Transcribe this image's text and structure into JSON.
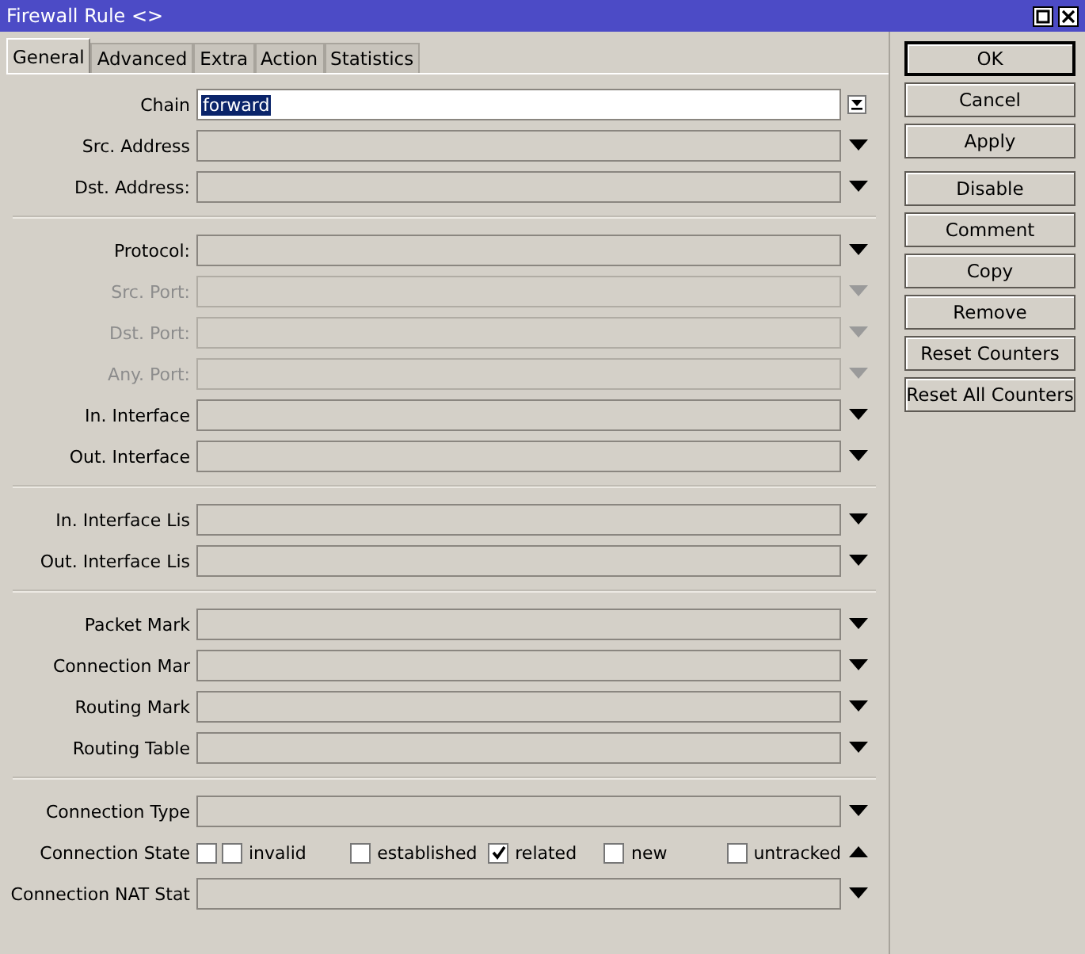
{
  "window": {
    "title": "Firewall Rule <>"
  },
  "tabs": [
    {
      "label": "General",
      "selected": true
    },
    {
      "label": "Advanced",
      "selected": false
    },
    {
      "label": "Extra",
      "selected": false
    },
    {
      "label": "Action",
      "selected": false
    },
    {
      "label": "Statistics",
      "selected": false
    }
  ],
  "groups": [
    [
      {
        "kind": "select",
        "label": "Chain",
        "value": "forward",
        "value_selected": true
      },
      {
        "kind": "combo",
        "label": "Src. Address",
        "disabled": false
      },
      {
        "kind": "combo",
        "label": "Dst. Address:",
        "disabled": false
      }
    ],
    [
      {
        "kind": "combo",
        "label": "Protocol:",
        "disabled": false
      },
      {
        "kind": "combo",
        "label": "Src. Port:",
        "disabled": true
      },
      {
        "kind": "combo",
        "label": "Dst. Port:",
        "disabled": true
      },
      {
        "kind": "combo",
        "label": "Any. Port:",
        "disabled": true
      },
      {
        "kind": "combo",
        "label": "In. Interface",
        "disabled": false
      },
      {
        "kind": "combo",
        "label": "Out. Interface",
        "disabled": false
      }
    ],
    [
      {
        "kind": "combo",
        "label": "In. Interface Lis",
        "disabled": false
      },
      {
        "kind": "combo",
        "label": "Out. Interface Lis",
        "disabled": false
      }
    ],
    [
      {
        "kind": "combo",
        "label": "Packet Mark",
        "disabled": false
      },
      {
        "kind": "combo",
        "label": "Connection Mar",
        "disabled": false
      },
      {
        "kind": "combo",
        "label": "Routing Mark",
        "disabled": false
      },
      {
        "kind": "combo",
        "label": "Routing Table",
        "disabled": false
      }
    ],
    [
      {
        "kind": "combo",
        "label": "Connection Type",
        "disabled": false
      },
      {
        "kind": "checks",
        "label": "Connection State",
        "negate": false,
        "options": [
          {
            "label": "invalid",
            "checked": false
          },
          {
            "label": "established",
            "checked": false
          },
          {
            "label": "related",
            "checked": true
          },
          {
            "label": "new",
            "checked": false
          },
          {
            "label": "untracked",
            "checked": false
          }
        ]
      },
      {
        "kind": "combo",
        "label": "Connection NAT Stat",
        "disabled": false
      }
    ]
  ],
  "button_groups": [
    [
      {
        "label": "OK",
        "default": true
      },
      {
        "label": "Cancel",
        "default": false
      },
      {
        "label": "Apply",
        "default": false
      }
    ],
    [
      {
        "label": "Disable",
        "default": false
      },
      {
        "label": "Comment",
        "default": false
      },
      {
        "label": "Copy",
        "default": false
      },
      {
        "label": "Remove",
        "default": false
      },
      {
        "label": "Reset Counters",
        "default": false
      },
      {
        "label": "Reset All Counters",
        "default": false
      }
    ]
  ]
}
